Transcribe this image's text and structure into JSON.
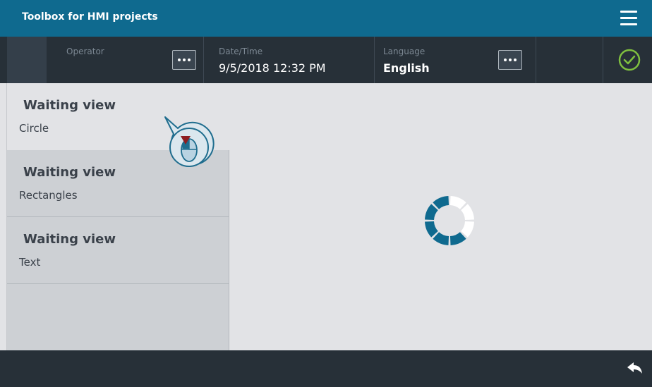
{
  "app": {
    "title": "Toolbox for HMI projects",
    "accent_color": "#0f6a8f",
    "menu_icon": "hamburger-menu-icon"
  },
  "infobar": {
    "operator": {
      "label": "Operator",
      "value": ""
    },
    "datetime": {
      "label": "Date/Time",
      "value": "9/5/2018 12:32 PM"
    },
    "language": {
      "label": "Language",
      "value": "English"
    },
    "status_icon": "check-circle-icon",
    "status_color": "#7fbf3f"
  },
  "sidebar": {
    "items": [
      {
        "title": "Waiting view",
        "subtitle": "Circle",
        "selected": true
      },
      {
        "title": "Waiting view",
        "subtitle": "Rectangles",
        "selected": false
      },
      {
        "title": "Waiting view",
        "subtitle": "Text",
        "selected": false
      }
    ]
  },
  "content": {
    "spinner_icon": "loading-circle-icon",
    "spinner_color": "#0f6a8f",
    "hint_icon": "mouse-click-hint-icon"
  },
  "bottombar": {
    "back_icon": "back-arrow-icon"
  }
}
